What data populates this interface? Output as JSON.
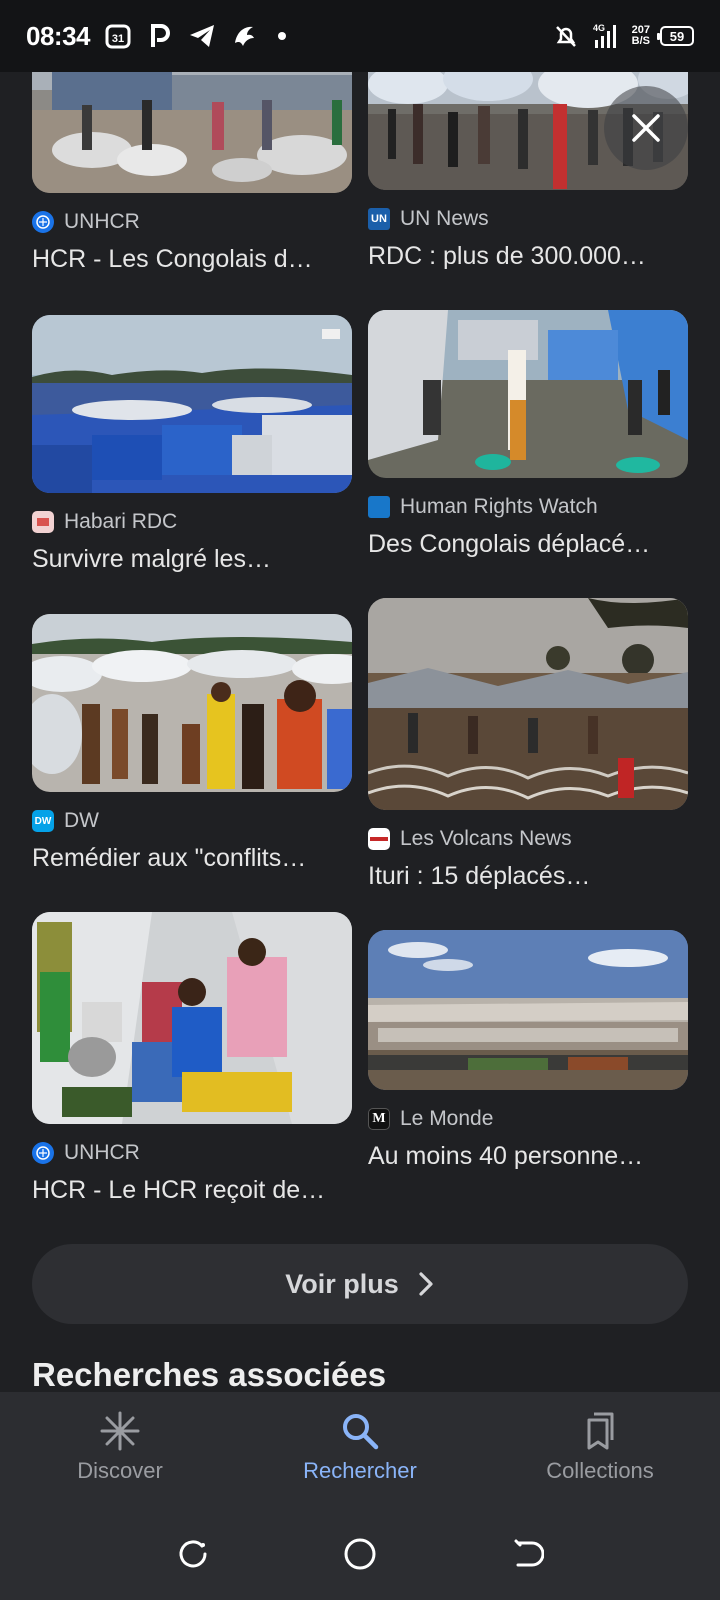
{
  "status_bar": {
    "time": "08:34",
    "left_icons": [
      "calendar-icon",
      "parking-p-icon",
      "telegram-icon",
      "bird-app-icon",
      "notification-dot"
    ],
    "network_top": "4G",
    "speed_value": "207",
    "speed_unit": "B/S",
    "battery": "59"
  },
  "results": [
    {
      "source": "UNHCR",
      "headline": "HCR - Les Congolais d…",
      "favicon_color": "#1a73e8"
    },
    {
      "source": "UN News",
      "headline": "RDC : plus de 300.000…",
      "favicon_color": "#1b5faa"
    },
    {
      "source": "Habari RDC",
      "headline": "Survivre malgré les…",
      "favicon_color": "#f2d2d2"
    },
    {
      "source": "Human Rights Watch",
      "headline": "Des Congolais déplacé…",
      "favicon_color": "#1877c9"
    },
    {
      "source": "DW",
      "headline": "Remédier aux \"conflits…",
      "favicon_color": "#05a2e8"
    },
    {
      "source": "Les Volcans News",
      "headline": "Ituri : 15 déplacés…",
      "favicon_color": "#ffffff"
    },
    {
      "source": "UNHCR",
      "headline": "HCR - Le HCR reçoit de…",
      "favicon_color": "#1a73e8"
    },
    {
      "source": "Le Monde",
      "headline": "Au moins 40 personne…",
      "favicon_color": "#111111"
    }
  ],
  "voir_plus_label": "Voir plus",
  "related_title": "Recherches associées",
  "bottom_nav": {
    "items": [
      {
        "label": "Discover",
        "icon": "asterisk-icon",
        "active": false
      },
      {
        "label": "Rechercher",
        "icon": "search-icon",
        "active": true
      },
      {
        "label": "Collections",
        "icon": "collections-icon",
        "active": false
      }
    ]
  },
  "accent_color": "#8ab4f8"
}
